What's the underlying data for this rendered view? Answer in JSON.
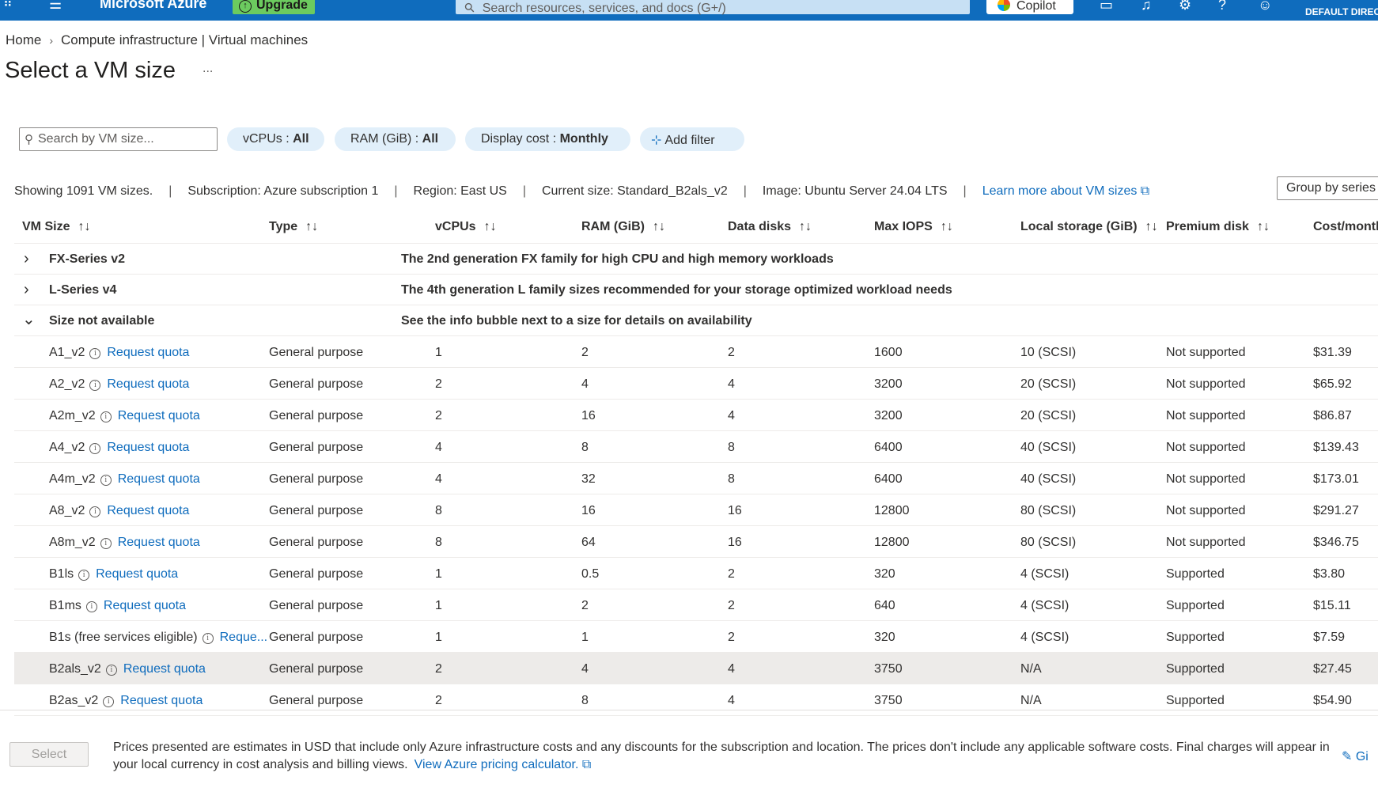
{
  "topbar": {
    "brand": "Microsoft Azure",
    "upgrade": "Upgrade",
    "search_placeholder": "Search resources, services, and docs (G+/)",
    "copilot": "Copilot",
    "account_directory": "DEFAULT DIRECT"
  },
  "breadcrumb": {
    "home": "Home",
    "current": "Compute infrastructure | Virtual machines"
  },
  "page": {
    "title": "Select a VM size",
    "more": "..."
  },
  "filters": {
    "search_placeholder": "Search by VM size...",
    "vcpus_label": "vCPUs : ",
    "vcpus_value": "All",
    "ram_label": "RAM (GiB) : ",
    "ram_value": "All",
    "cost_label": "Display cost : ",
    "cost_value": "Monthly",
    "add_filter": "Add filter"
  },
  "summary": {
    "showing": "Showing 1091 VM sizes.",
    "subscription": "Subscription: Azure subscription 1",
    "region": "Region: East US",
    "current_size": "Current size: Standard_B2als_v2",
    "image": "Image: Ubuntu Server 24.04 LTS",
    "learn_more": "Learn more about VM sizes",
    "group_by": "Group by series"
  },
  "table": {
    "headers": [
      "VM Size",
      "Type",
      "vCPUs",
      "RAM (GiB)",
      "Data disks",
      "Max IOPS",
      "Local storage (GiB)",
      "Premium disk",
      "Cost/month"
    ],
    "groups": [
      {
        "name": "FX-Series v2",
        "desc": "The 2nd generation FX family for high CPU and high memory workloads"
      },
      {
        "name": "L-Series v4",
        "desc": "The 4th generation L family sizes recommended for your storage optimized workload needs"
      },
      {
        "name": "Size not available",
        "desc": "See the info bubble next to a size for details on availability"
      }
    ],
    "rows": [
      {
        "size": "A1_v2",
        "quota": "Request quota",
        "type": "General purpose",
        "vcpus": "1",
        "ram": "2",
        "disks": "2",
        "iops": "1600",
        "storage": "10 (SCSI)",
        "premium": "Not supported",
        "cost": "$31.39"
      },
      {
        "size": "A2_v2",
        "quota": "Request quota",
        "type": "General purpose",
        "vcpus": "2",
        "ram": "4",
        "disks": "4",
        "iops": "3200",
        "storage": "20 (SCSI)",
        "premium": "Not supported",
        "cost": "$65.92"
      },
      {
        "size": "A2m_v2",
        "quota": "Request quota",
        "type": "General purpose",
        "vcpus": "2",
        "ram": "16",
        "disks": "4",
        "iops": "3200",
        "storage": "20 (SCSI)",
        "premium": "Not supported",
        "cost": "$86.87"
      },
      {
        "size": "A4_v2",
        "quota": "Request quota",
        "type": "General purpose",
        "vcpus": "4",
        "ram": "8",
        "disks": "8",
        "iops": "6400",
        "storage": "40 (SCSI)",
        "premium": "Not supported",
        "cost": "$139.43"
      },
      {
        "size": "A4m_v2",
        "quota": "Request quota",
        "type": "General purpose",
        "vcpus": "4",
        "ram": "32",
        "disks": "8",
        "iops": "6400",
        "storage": "40 (SCSI)",
        "premium": "Not supported",
        "cost": "$173.01"
      },
      {
        "size": "A8_v2",
        "quota": "Request quota",
        "type": "General purpose",
        "vcpus": "8",
        "ram": "16",
        "disks": "16",
        "iops": "12800",
        "storage": "80 (SCSI)",
        "premium": "Not supported",
        "cost": "$291.27"
      },
      {
        "size": "A8m_v2",
        "quota": "Request quota",
        "type": "General purpose",
        "vcpus": "8",
        "ram": "64",
        "disks": "16",
        "iops": "12800",
        "storage": "80 (SCSI)",
        "premium": "Not supported",
        "cost": "$346.75"
      },
      {
        "size": "B1ls",
        "quota": "Request quota",
        "type": "General purpose",
        "vcpus": "1",
        "ram": "0.5",
        "disks": "2",
        "iops": "320",
        "storage": "4 (SCSI)",
        "premium": "Supported",
        "cost": "$3.80"
      },
      {
        "size": "B1ms",
        "quota": "Request quota",
        "type": "General purpose",
        "vcpus": "1",
        "ram": "2",
        "disks": "2",
        "iops": "640",
        "storage": "4 (SCSI)",
        "premium": "Supported",
        "cost": "$15.11"
      },
      {
        "size": "B1s (free services eligible)",
        "quota": "Reque...",
        "type": "General purpose",
        "vcpus": "1",
        "ram": "1",
        "disks": "2",
        "iops": "320",
        "storage": "4 (SCSI)",
        "premium": "Supported",
        "cost": "$7.59"
      },
      {
        "size": "B2als_v2",
        "quota": "Request quota",
        "type": "General purpose",
        "vcpus": "2",
        "ram": "4",
        "disks": "4",
        "iops": "3750",
        "storage": "N/A",
        "premium": "Supported",
        "cost": "$27.45"
      },
      {
        "size": "B2as_v2",
        "quota": "Request quota",
        "type": "General purpose",
        "vcpus": "2",
        "ram": "8",
        "disks": "4",
        "iops": "3750",
        "storage": "N/A",
        "premium": "Supported",
        "cost": "$54.90"
      }
    ]
  },
  "footer": {
    "select": "Select",
    "note": "Prices presented are estimates in USD that include only Azure infrastructure costs and any discounts for the subscription and location. The prices don't include any applicable software costs. Final charges will appear in your local currency in cost analysis and billing views.",
    "calculator_link": "View Azure pricing calculator.",
    "feedback": "Gi"
  }
}
